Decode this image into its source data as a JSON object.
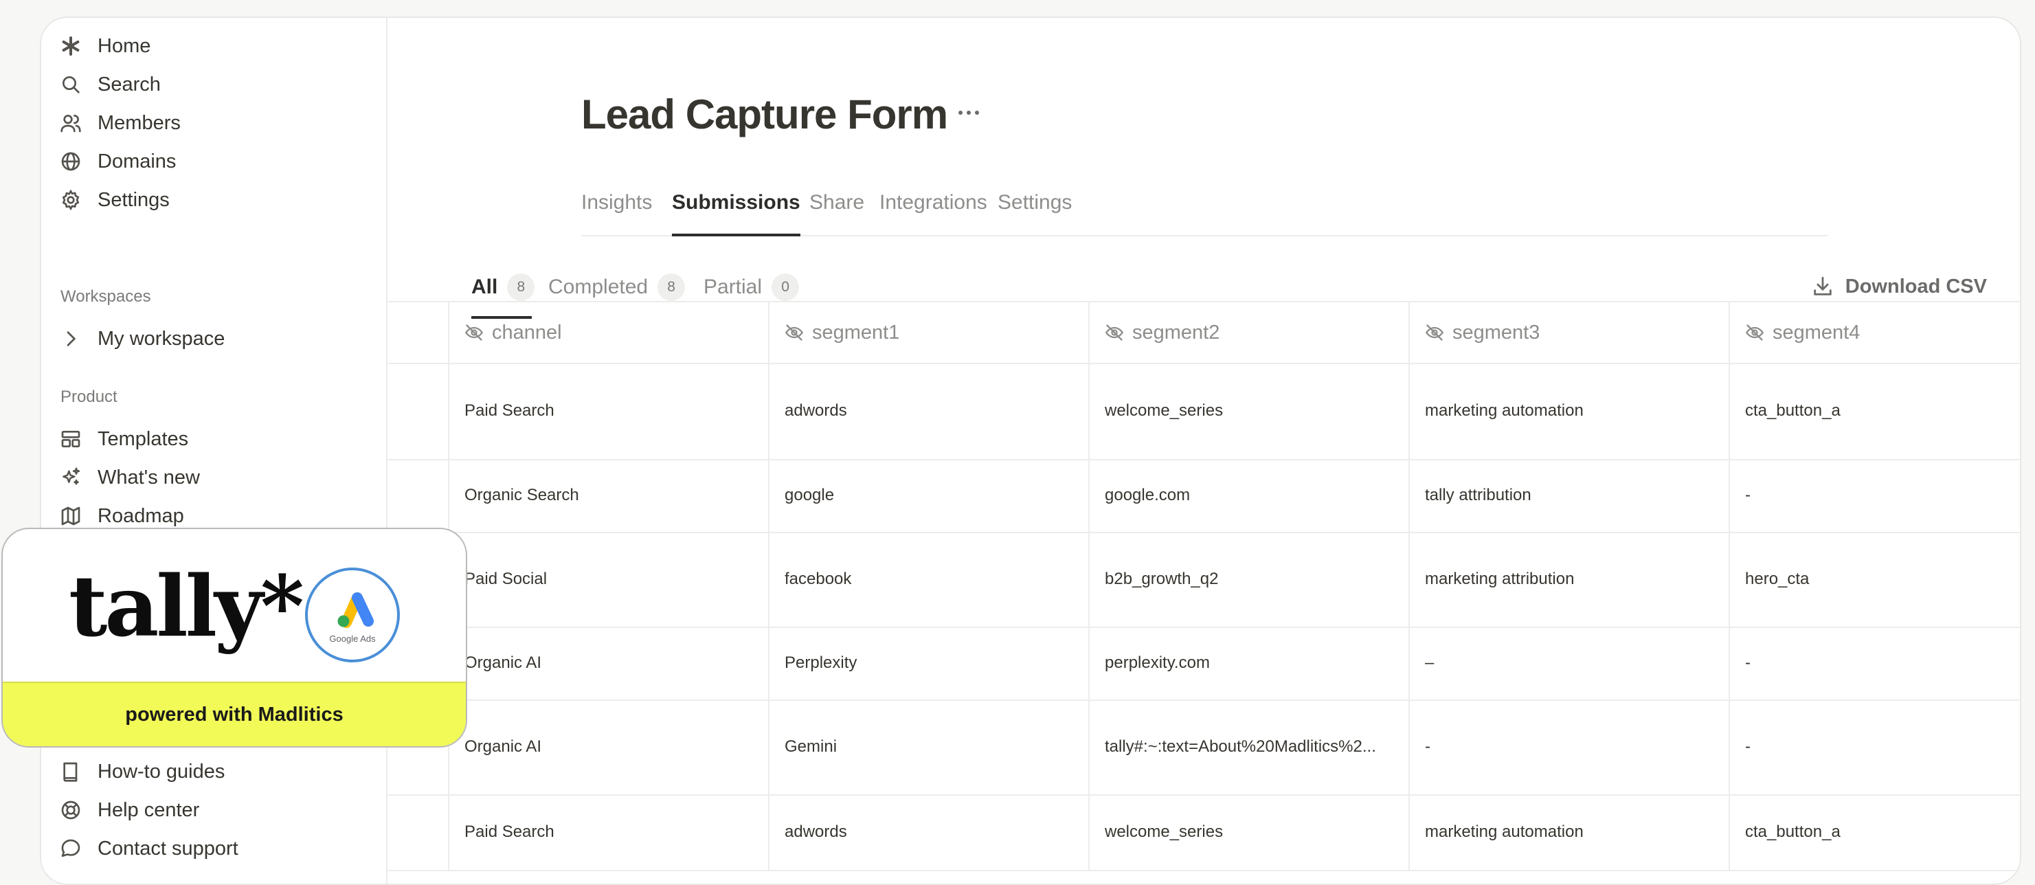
{
  "sidebar": {
    "top_items": [
      {
        "label": "Home",
        "icon": "asterisk-icon"
      },
      {
        "label": "Search",
        "icon": "search-icon"
      },
      {
        "label": "Members",
        "icon": "members-icon"
      },
      {
        "label": "Domains",
        "icon": "globe-icon"
      },
      {
        "label": "Settings",
        "icon": "gear-icon"
      }
    ],
    "workspaces_label": "Workspaces",
    "workspace_item": "My workspace",
    "product_label": "Product",
    "product_items": [
      {
        "label": "Templates",
        "icon": "templates-icon"
      },
      {
        "label": "What's new",
        "icon": "sparkles-icon"
      },
      {
        "label": "Roadmap",
        "icon": "map-icon"
      }
    ],
    "help_items": [
      {
        "label": "How-to guides",
        "icon": "book-icon"
      },
      {
        "label": "Help center",
        "icon": "lifebuoy-icon"
      },
      {
        "label": "Contact support",
        "icon": "chat-bubble-icon"
      }
    ]
  },
  "page": {
    "title": "Lead Capture Form",
    "tabs": [
      "Insights",
      "Submissions",
      "Share",
      "Integrations",
      "Settings"
    ],
    "active_tab": "Submissions"
  },
  "subtabs": [
    {
      "label": "All",
      "count": "8"
    },
    {
      "label": "Completed",
      "count": "8"
    },
    {
      "label": "Partial",
      "count": "0"
    }
  ],
  "download_label": "Download CSV",
  "table": {
    "columns": [
      "channel",
      "segment1",
      "segment2",
      "segment3",
      "segment4"
    ],
    "rows": [
      [
        "Paid Search",
        "adwords",
        "welcome_series",
        "marketing automation",
        "cta_button_a"
      ],
      [
        "Organic Search",
        "google",
        "google.com",
        "tally attribution",
        "-"
      ],
      [
        "Paid Social",
        "facebook",
        "b2b_growth_q2",
        "marketing attribution",
        "hero_cta"
      ],
      [
        "Organic AI",
        "Perplexity",
        "perplexity.com",
        "–",
        "-"
      ],
      [
        "Organic AI",
        "Gemini",
        "tally#:~:text=About%20Madlitics%2...",
        "-",
        "-"
      ],
      [
        "Paid Search",
        "adwords",
        "welcome_series",
        "marketing automation",
        "cta_button_a"
      ]
    ]
  },
  "promo": {
    "logo_text": "tally*",
    "badge_label": "Google Ads",
    "footer_text": "powered with Madlitics",
    "footer_color": "#f1fa57"
  }
}
